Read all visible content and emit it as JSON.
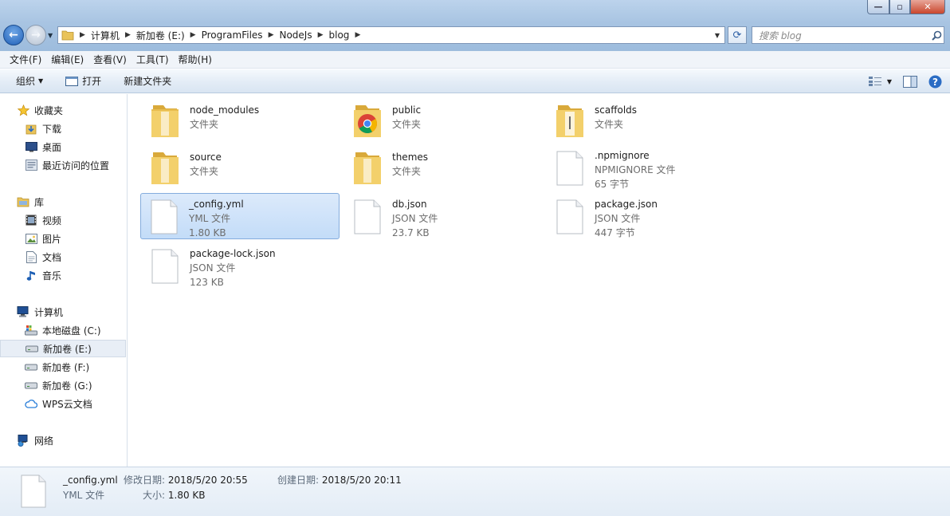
{
  "window": {
    "controls": {
      "minimize": "—",
      "maximize": "▫",
      "close": "✕"
    }
  },
  "address": {
    "crumbs": [
      "计算机",
      "新加卷 (E:)",
      "ProgramFiles",
      "NodeJs",
      "blog"
    ]
  },
  "search": {
    "placeholder": "搜索 blog"
  },
  "menu": [
    "文件(F)",
    "编辑(E)",
    "查看(V)",
    "工具(T)",
    "帮助(H)"
  ],
  "commands": {
    "organize": "组织",
    "open": "打开",
    "new_folder": "新建文件夹"
  },
  "nav": {
    "favorites": {
      "label": "收藏夹",
      "items": [
        "下载",
        "桌面",
        "最近访问的位置"
      ]
    },
    "libraries": {
      "label": "库",
      "items": [
        "视频",
        "图片",
        "文档",
        "音乐"
      ]
    },
    "computer": {
      "label": "计算机",
      "items": [
        "本地磁盘 (C:)",
        "新加卷 (E:)",
        "新加卷 (F:)",
        "新加卷 (G:)",
        "WPS云文档"
      ]
    },
    "network": {
      "label": "网络"
    }
  },
  "files": [
    {
      "name": "node_modules",
      "type": "文件夹",
      "size": ""
    },
    {
      "name": "public",
      "type": "文件夹",
      "size": ""
    },
    {
      "name": "scaffolds",
      "type": "文件夹",
      "size": ""
    },
    {
      "name": "source",
      "type": "文件夹",
      "size": ""
    },
    {
      "name": "themes",
      "type": "文件夹",
      "size": ""
    },
    {
      "name": ".npmignore",
      "type": "NPMIGNORE 文件",
      "size": "65 字节"
    },
    {
      "name": "_config.yml",
      "type": "YML 文件",
      "size": "1.80 KB"
    },
    {
      "name": "db.json",
      "type": "JSON 文件",
      "size": "23.7 KB"
    },
    {
      "name": "package.json",
      "type": "JSON 文件",
      "size": "447 字节"
    },
    {
      "name": "package-lock.json",
      "type": "JSON 文件",
      "size": "123 KB"
    }
  ],
  "details": {
    "name": "_config.yml",
    "type": "YML 文件",
    "modified_label": "修改日期:",
    "modified": "2018/5/20 20:55",
    "size_label": "大小:",
    "size": "1.80 KB",
    "created_label": "创建日期:",
    "created": "2018/5/20 20:11"
  },
  "colors": {
    "selection": "#cfe3fb",
    "folder": "#f2c84b",
    "accent": "#2a6cc4"
  }
}
